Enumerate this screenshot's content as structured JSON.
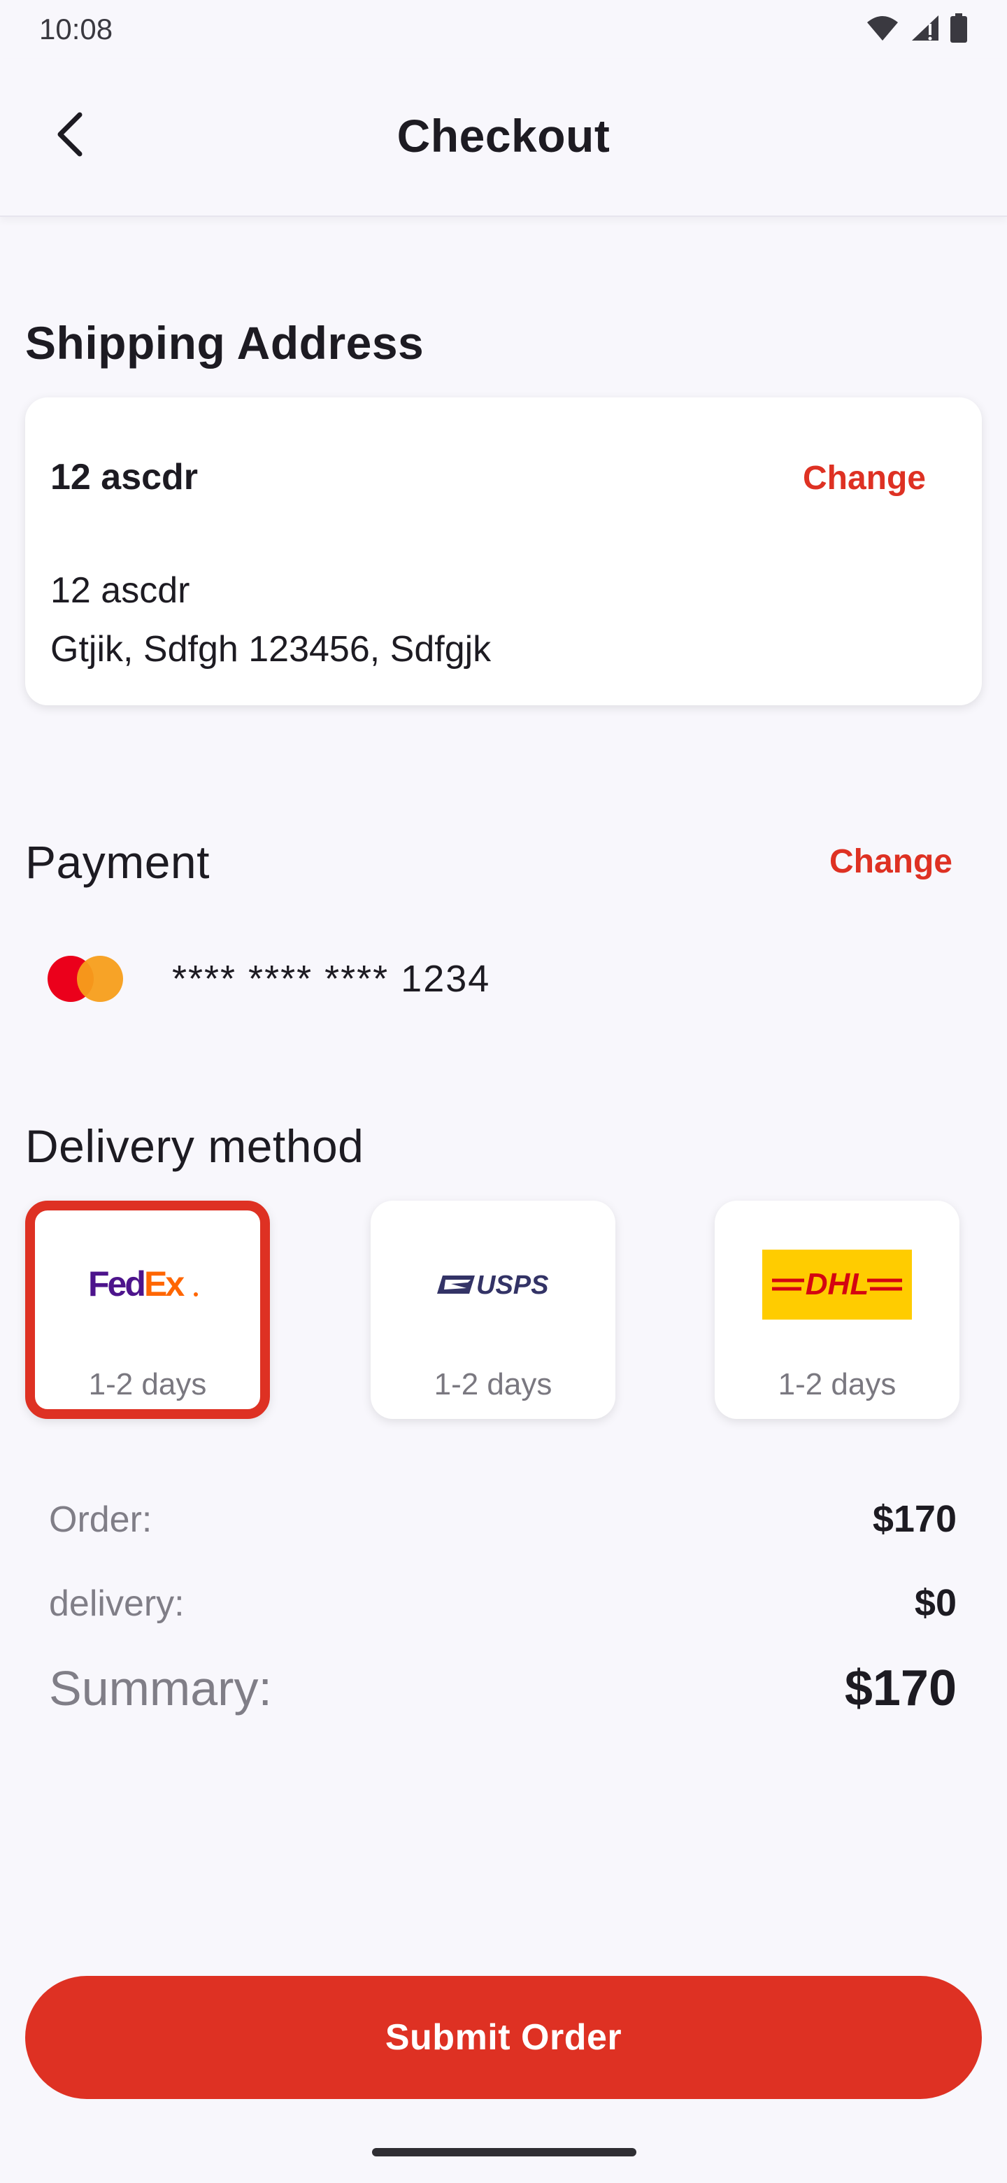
{
  "status_bar": {
    "time": "10:08",
    "icons": [
      "wifi-icon",
      "cell-signal-icon",
      "battery-icon"
    ]
  },
  "app_bar": {
    "title": "Checkout",
    "back_icon": "chevron-left-icon"
  },
  "shipping": {
    "section_title": "Shipping Address",
    "name": "12 ascdr",
    "change_label": "Change",
    "line1": "12 ascdr",
    "line2": "Gtjik, Sdfgh 123456, Sdfgjk"
  },
  "payment": {
    "section_title": "Payment",
    "change_label": "Change",
    "card_brand_icon": "mastercard-icon",
    "card_number": "**** **** **** 1234"
  },
  "delivery": {
    "section_title": "Delivery method",
    "options": [
      {
        "carrier": "FedEx",
        "logo_icon": "fedex-logo",
        "days": "1-2 days",
        "selected": true
      },
      {
        "carrier": "USPS",
        "logo_icon": "usps-logo",
        "days": "1-2 days",
        "selected": false
      },
      {
        "carrier": "DHL",
        "logo_icon": "dhl-logo",
        "days": "1-2 days",
        "selected": false
      }
    ]
  },
  "summary": {
    "order_label": "Order:",
    "order_value": "$170",
    "delivery_label": "delivery:",
    "delivery_value": "$0",
    "total_label": "Summary:",
    "total_value": "$170"
  },
  "submit_label": "Submit Order",
  "colors": {
    "accent": "#de3123",
    "background": "#f8f7fc",
    "fedex_purple": "#4d148c",
    "fedex_orange": "#ff6600",
    "usps_blue": "#333366",
    "dhl_yellow": "#ffcc00",
    "dhl_red": "#d40511"
  }
}
